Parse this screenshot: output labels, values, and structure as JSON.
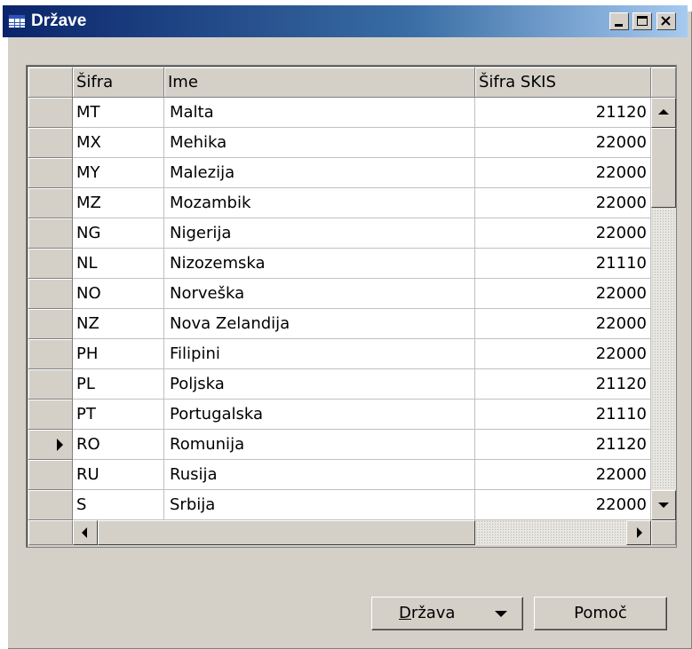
{
  "window": {
    "title": "Države"
  },
  "grid": {
    "columns": [
      "Šifra",
      "Ime",
      "Šifra SKIS"
    ],
    "current_row": 11,
    "rows": [
      {
        "code": "MT",
        "name": "Malta",
        "skis": "21120"
      },
      {
        "code": "MX",
        "name": "Mehika",
        "skis": "22000"
      },
      {
        "code": "MY",
        "name": "Malezija",
        "skis": "22000"
      },
      {
        "code": "MZ",
        "name": "Mozambik",
        "skis": "22000"
      },
      {
        "code": "NG",
        "name": "Nigerija",
        "skis": "22000"
      },
      {
        "code": "NL",
        "name": "Nizozemska",
        "skis": "21110"
      },
      {
        "code": "NO",
        "name": "Norveška",
        "skis": "22000"
      },
      {
        "code": "NZ",
        "name": "Nova Zelandija",
        "skis": "22000"
      },
      {
        "code": "PH",
        "name": "Filipini",
        "skis": "22000"
      },
      {
        "code": "PL",
        "name": "Poljska",
        "skis": "21120"
      },
      {
        "code": "PT",
        "name": "Portugalska",
        "skis": "21110"
      },
      {
        "code": "RO",
        "name": "Romunija",
        "skis": "21120"
      },
      {
        "code": "RU",
        "name": "Rusija",
        "skis": "22000"
      },
      {
        "code": "S",
        "name": "Srbija",
        "skis": "22000"
      }
    ]
  },
  "buttons": {
    "drzava_mnemonic": "D",
    "drzava_rest": "ržava",
    "pomoc": "Pomoč"
  }
}
